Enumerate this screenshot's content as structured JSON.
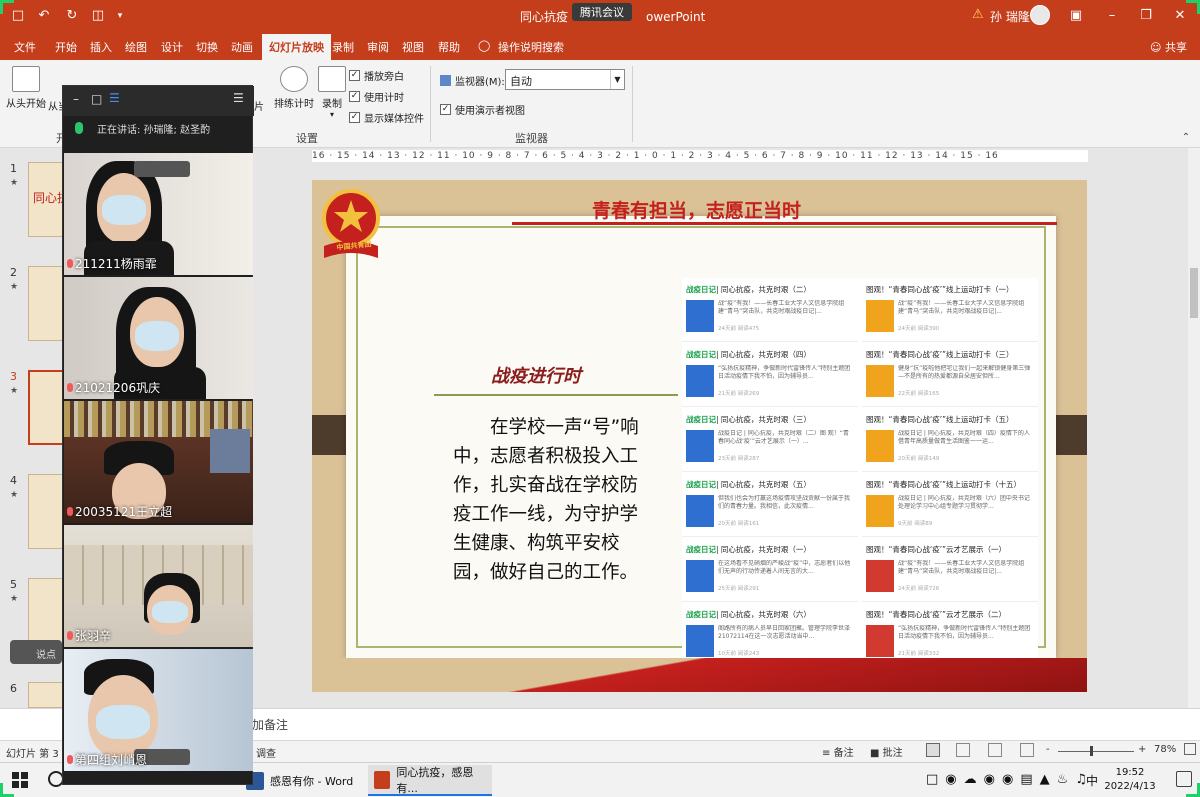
{
  "titlebar": {
    "doc_title_prefix": "同心抗疫",
    "app_suffix": "owerPoint",
    "meeting_label": "腾讯会议",
    "user": "孙 瑞隆"
  },
  "ribbon_tabs": [
    "文件",
    "开始",
    "插入",
    "绘图",
    "设计",
    "切换",
    "动画",
    "幻灯片放映",
    "录制",
    "审阅",
    "视图",
    "帮助"
  ],
  "active_tab": "幻灯片放映",
  "tell_me": "操作说明搜索",
  "share": "共享",
  "ribbon": {
    "from_start": "从头开始",
    "from_current": "从当",
    "rehearse": "排练计时",
    "record": "录制",
    "play_narration": "播放旁白",
    "use_timings": "使用计时",
    "show_media_controls": "显示媒体控件",
    "monitor_label": "监视器(M):",
    "monitor_value": "自动",
    "presenter_view": "使用演示者视图",
    "group_setup": "设置",
    "group_monitors": "监视器",
    "group_start_cut": "开",
    "pian": "片"
  },
  "thumbnails": [
    {
      "num": "1",
      "label": "同心抗"
    },
    {
      "num": "2",
      "label": ""
    },
    {
      "num": "3",
      "label": ""
    },
    {
      "num": "4",
      "label": ""
    },
    {
      "num": "5",
      "label": ""
    },
    {
      "num": "6",
      "label": ""
    }
  ],
  "ruler_text": "16 · 15 · 14 · 13 · 12 · 11 · 10 · 9 · 8 · 7 · 6 · 5 · 4 · 3 · 2 · 1 · 0 · 1 · 2 · 3 · 4 · 5 · 6 · 7 · 8 · 9 · 10 · 11 · 12 · 13 · 14 · 15 · 16",
  "slide": {
    "title": "青春有担当，志愿正当时",
    "section_title": "战疫进行时",
    "body": "在学校一声“号”响中，志愿者积极投入工作，扎实奋战在学校防疫工作一线，为守护学生健康、构筑平安校园，做好自己的工作。",
    "emblem_text": "中国共青团",
    "cards_left": [
      {
        "tag": "战疫日记",
        "title": "| 同心抗疫，共克时艰（二）",
        "desc": "战“疫”有我！——长春工业大学人文信息学院组建“青马”突击队，共克时艰战疫日记|...",
        "meta": "24天前 阅读475"
      },
      {
        "tag": "战疫日记",
        "title": "| 同心抗疫，共克时艰（四）",
        "desc": "“弘扬抗疫精神，争做新时代雷锋传人”特别主题团日活动疫情下我不怕，因为辅导员...",
        "meta": "21天前 阅读269"
      },
      {
        "tag": "战疫日记",
        "title": "| 同心抗疫，共克时艰（三）",
        "desc": "战疫日记 | 同心抗疫，共克时艰（二）图 观！“青春同心战‘疫’”云才艺展示（一）...",
        "meta": "23天前 阅读287"
      },
      {
        "tag": "战疫日记",
        "title": "| 同心抗疫，共克时艰（五）",
        "desc": "但我们也会为打赢这场疫情攻坚战贡献一份属于我们的青春力量。我相信，此次疫情...",
        "meta": "20天前 阅读161"
      },
      {
        "tag": "战疫日记",
        "title": "| 同心抗疫，共克时艰（一）",
        "desc": "在这场看不见硝烟的严峻战“疫”中，志愿者们以他们无声的行动传递着人间无言的大...",
        "meta": "25天前 阅读291"
      },
      {
        "tag": "战疫日记",
        "title": "| 同心抗疫，共克时艰（六）",
        "desc": "阁路所有的病人员早日回家团聚。管理学院李世泽 21072114在这一次志愿活动当中...",
        "meta": "10天前 阅读243"
      }
    ],
    "cards_right": [
      {
        "title": "图观！“青春同心战‘疫’”线上运动打卡（一）",
        "desc": "战“疫”有我！——长春工业大学人文信息学院组建“青马”突击队，共克时艰战疫日记|...",
        "meta": "24天前 阅读390"
      },
      {
        "title": "图观！“青春同心战‘疫’”线上运动打卡（三）",
        "desc": "健身“抗”疫啦他把宅让我们一起来解锁健身第三弹—不是所有的热爱都源自朵居安但所...",
        "meta": "22天前 阅读165"
      },
      {
        "title": "图观！“青春同心战‘疫’”线上运动打卡（五）",
        "desc": "战疫日记 | 同心抗疫，共克时艰（四）疫情下的人借青年高质量做青生活图鉴一一运...",
        "meta": "20天前 阅读149"
      },
      {
        "title": "图观！“青春同心战‘疫’”线上运动打卡（十五）",
        "desc": "战疫日记 | 同心抗疫，共克时艰（六）团中央书记处理论学习中心组专题学习贯彻学...",
        "meta": "9天前 阅读89"
      },
      {
        "title": "图观！“青春同心战‘疫’”云才艺展示（一）",
        "desc": "战“疫”有我！——长春工业大学人文信息学院组建“青马”突击队，共克时艰战疫日记|...",
        "meta": "24天前 阅读726"
      },
      {
        "title": "图观！“青春同心战‘疫’”云才艺展示（二）",
        "desc": "“弘扬抗疫精神，争做新时代雷锋传人”特别主题团日活动疫情下我不怕，因为辅导员...",
        "meta": "21天前 阅读332"
      }
    ]
  },
  "meeting": {
    "speaking_label": "正在讲话: 孙瑞隆; 赵圣酌",
    "participants": [
      "211211杨雨霏",
      "21021206巩庆",
      "20035121王立超",
      "张羽辛",
      "第四组刘峭恩"
    ]
  },
  "notes_placeholder": "加备注",
  "status": {
    "slide_info": "幻灯片 第 3 张",
    "accessibility": "调查",
    "notes": "备注",
    "comments": "批注",
    "zoom": "78%",
    "zoom_minus": "-",
    "zoom_plus": "+"
  },
  "taskbar": {
    "apps": [
      {
        "label": "感恩有你 - Word",
        "color": "#2b5797"
      },
      {
        "label": "同心抗疫，感恩有...",
        "color": "#c43e1c"
      }
    ],
    "ime": "中",
    "time": "19:52",
    "date": "2022/4/13"
  },
  "side_hint": "说点"
}
